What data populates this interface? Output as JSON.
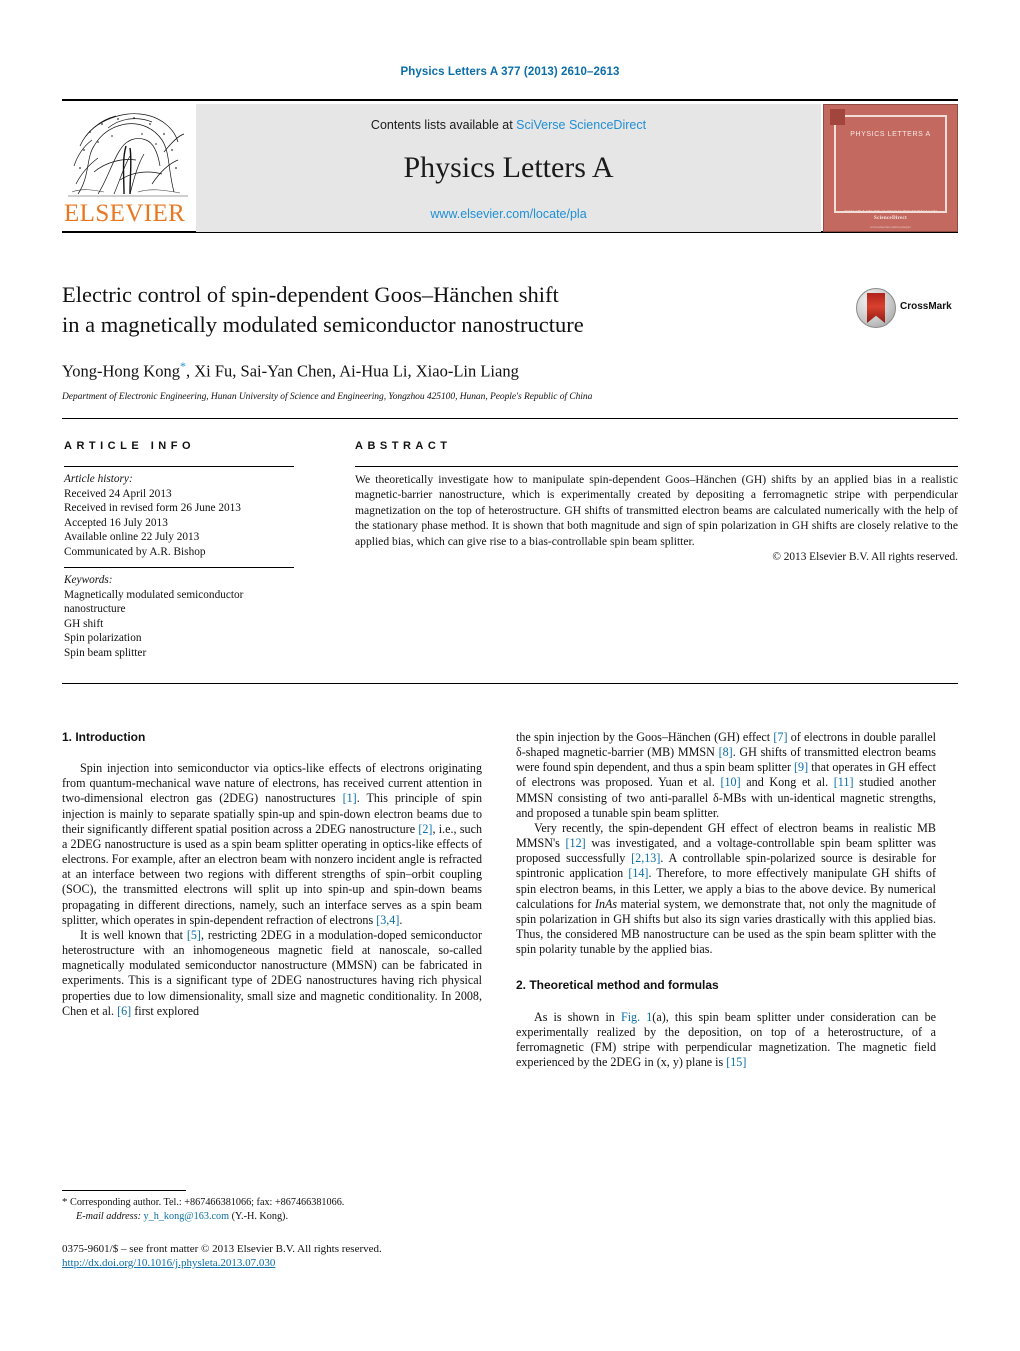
{
  "running_head": "Physics Letters A 377 (2013) 2610–2613",
  "masthead": {
    "contents_prefix": "Contents lists available at ",
    "contents_link": "SciVerse ScienceDirect",
    "journal_title": "Physics Letters A",
    "journal_url": "www.elsevier.com/locate/pla",
    "publisher_logo_text": "ELSEVIER",
    "cover": {
      "title": "PHYSICS LETTERS A",
      "foot_small": "AVAILABLE ONLINE AT WWW.SCIENCEDIRECT.COM",
      "foot_bold": "ScienceDirect",
      "foot_tiny": "www.elsevier.com/locate/pla"
    }
  },
  "article": {
    "title_line1": "Electric control of spin-dependent Goos–Hänchen shift",
    "title_line2": "in a magnetically modulated semiconductor nanostructure",
    "authors": "Yong-Hong Kong",
    "authors_rest": ", Xi Fu, Sai-Yan Chen, Ai-Hua Li, Xiao-Lin Liang",
    "corresponding_marker": "*",
    "affiliation": "Department of Electronic Engineering, Hunan University of Science and Engineering, Yongzhou 425100, Hunan, People's Republic of China",
    "crossmark_label": "CrossMark"
  },
  "headers": {
    "article_info": "ARTICLE INFO",
    "abstract": "ABSTRACT"
  },
  "history": {
    "label": "Article history:",
    "lines": [
      "Received 24 April 2013",
      "Received in revised form 26 June 2013",
      "Accepted 16 July 2013",
      "Available online 22 July 2013",
      "Communicated by A.R. Bishop"
    ]
  },
  "keywords": {
    "label": "Keywords:",
    "lines": [
      "Magnetically modulated semiconductor",
      "nanostructure",
      "GH shift",
      "Spin polarization",
      "Spin beam splitter"
    ]
  },
  "abstract": {
    "text": "We theoretically investigate how to manipulate spin-dependent Goos–Hänchen (GH) shifts by an applied bias in a realistic magnetic-barrier nanostructure, which is experimentally created by depositing a ferromagnetic stripe with perpendicular magnetization on the top of heterostructure. GH shifts of transmitted electron beams are calculated numerically with the help of the stationary phase method. It is shown that both magnitude and sign of spin polarization in GH shifts are closely relative to the applied bias, which can give rise to a bias-controllable spin beam splitter.",
    "copyright": "© 2013 Elsevier B.V. All rights reserved."
  },
  "body": {
    "section1_heading": "1. Introduction",
    "section2_heading": "2. Theoretical method and formulas",
    "left_p1_a": "Spin injection into semiconductor via optics-like effects of electrons originating from quantum-mechanical wave nature of electrons, has received current attention in two-dimensional electron gas (2DEG) nanostructures ",
    "left_p1_r1": "[1]",
    "left_p1_b": ". This principle of spin injection is mainly to separate spatially spin-up and spin-down electron beams due to their significantly different spatial position across a 2DEG nanostructure ",
    "left_p1_r2": "[2]",
    "left_p1_c": ", i.e., such a 2DEG nanostructure is used as a spin beam splitter operating in optics-like effects of electrons. For example, after an electron beam with nonzero incident angle is refracted at an interface between two regions with different strengths of spin–orbit coupling (SOC), the transmitted electrons will split up into spin-up and spin-down beams propagating in different directions, namely, such an interface serves as a spin beam splitter, which operates in spin-dependent refraction of electrons ",
    "left_p1_r3": "[3,4]",
    "left_p1_d": ".",
    "left_p2_a": "It is well known that ",
    "left_p2_r1": "[5]",
    "left_p2_b": ", restricting 2DEG in a modulation-doped semiconductor heterostructure with an inhomogeneous magnetic field at nanoscale, so-called magnetically modulated semiconductor nanostructure (MMSN) can be fabricated in experiments. This is a significant type of 2DEG nanostructures having rich physical properties due to low dimensionality, small size and magnetic conditionality. In 2008, Chen et al. ",
    "left_p2_r2": "[6]",
    "left_p2_c": " first explored",
    "right_p1_a": "the spin injection by the Goos–Hänchen (GH) effect ",
    "right_p1_r1": "[7]",
    "right_p1_b": " of electrons in double parallel δ-shaped magnetic-barrier (MB) MMSN ",
    "right_p1_r2": "[8]",
    "right_p1_c": ". GH shifts of transmitted electron beams were found spin dependent, and thus a spin beam splitter ",
    "right_p1_r3": "[9]",
    "right_p1_d": " that operates in GH effect of electrons was proposed. Yuan et al. ",
    "right_p1_r4": "[10]",
    "right_p1_e": " and Kong et al. ",
    "right_p1_r5": "[11]",
    "right_p1_f": " studied another MMSN consisting of two anti-parallel δ-MBs with un-identical magnetic strengths, and proposed a tunable spin beam splitter.",
    "right_p2_a": "Very recently, the spin-dependent GH effect of electron beams in realistic MB MMSN's ",
    "right_p2_r1": "[12]",
    "right_p2_b": " was investigated, and a voltage-controllable spin beam splitter was proposed successfully ",
    "right_p2_r2": "[2,13]",
    "right_p2_c": ". A controllable spin-polarized source is desirable for spintronic application ",
    "right_p2_r3": "[14]",
    "right_p2_d": ". Therefore, to more effectively manipulate GH shifts of spin electron beams, in this Letter, we apply a bias to the above device. By numerical calculations for ",
    "right_p2_it": "InAs",
    "right_p2_e": " material system, we demonstrate that, not only the magnitude of spin polarization in GH shifts but also its sign varies drastically with this applied bias. Thus, the considered MB nanostructure can be used as the spin beam splitter with the spin polarity tunable by the applied bias.",
    "right_p3_a": "As is shown in ",
    "right_p3_r1": "Fig. 1",
    "right_p3_b": "(a), this spin beam splitter under consideration can be experimentally realized by the deposition, on top of a heterostructure, of a ferromagnetic (FM) stripe with perpendicular magnetization. The magnetic field experienced by the 2DEG in (x, y) plane is ",
    "right_p3_r2": "[15]"
  },
  "footer": {
    "footnote_star": "*",
    "footnote_text": "Corresponding author. Tel.: +867466381066; fax: +867466381066.",
    "email_label": "E-mail address:",
    "email": "y_h_kong@163.com",
    "email_suffix": "(Y.-H. Kong).",
    "imprint_line": "0375-9601/$ – see front matter © 2013 Elsevier B.V. All rights reserved.",
    "doi": "http://dx.doi.org/10.1016/j.physleta.2013.07.030"
  }
}
